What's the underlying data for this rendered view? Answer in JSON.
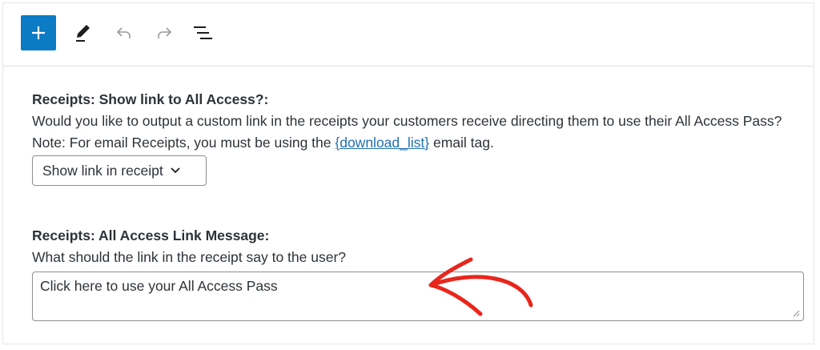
{
  "toolbar": {
    "add_icon": "plus-icon",
    "edit_icon": "pencil-icon",
    "undo_icon": "undo-icon",
    "redo_icon": "redo-icon",
    "outline_icon": "list-view-icon",
    "accent": "#0a7bc4"
  },
  "settings": {
    "show_link": {
      "label": "Receipts: Show link to All Access?:",
      "description_before": "Would you like to output a custom link in the receipts your customers receive directing them to use their All Access Pass? Note: For email Receipts, you must be using the ",
      "description_link": "{download_list}",
      "description_after": " email tag.",
      "select_value": "Show link in receipt"
    },
    "link_message": {
      "label": "Receipts: All Access Link Message:",
      "description": "What should the link in the receipt say to the user?",
      "value": "Click here to use your All Access Pass"
    }
  },
  "annotation": {
    "arrow_color": "#e8261c"
  }
}
